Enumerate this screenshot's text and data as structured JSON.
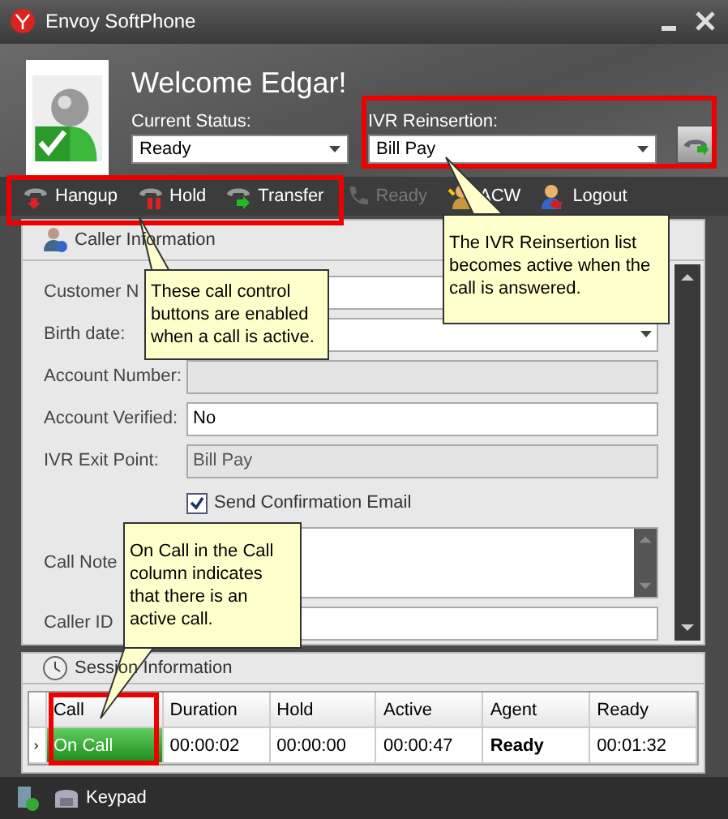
{
  "window": {
    "title": "Envoy SoftPhone"
  },
  "header": {
    "welcome": "Welcome Edgar!",
    "status_label": "Current Status:",
    "status_value": "Ready",
    "ivr_label": "IVR Reinsertion:",
    "ivr_value": "Bill Pay"
  },
  "toolbar": [
    {
      "label": "Hangup",
      "disabled": false
    },
    {
      "label": "Hold",
      "disabled": false
    },
    {
      "label": "Transfer",
      "disabled": false
    },
    {
      "label": "Ready",
      "disabled": true
    },
    {
      "label": "ACW",
      "disabled": false
    },
    {
      "label": "Logout",
      "disabled": false
    }
  ],
  "caller_panel": {
    "title": "Caller Information",
    "fields": [
      {
        "kind": "text",
        "label": "Customer N"
      },
      {
        "kind": "dropdown",
        "label": "Birth date:"
      },
      {
        "kind": "readonly",
        "label": "Account Number:"
      },
      {
        "kind": "text",
        "label": "Account Verified:",
        "value": "No"
      },
      {
        "kind": "readonly",
        "label": "IVR Exit Point:",
        "value": "Bill Pay"
      },
      {
        "kind": "checkbox",
        "label": "Send Confirmation Email",
        "checked": true
      },
      {
        "kind": "textarea",
        "label": "Call Note"
      },
      {
        "kind": "text",
        "label": "Caller ID"
      }
    ]
  },
  "session_panel": {
    "title": "Session Information",
    "columns": [
      "Call",
      "Duration",
      "Hold",
      "Active",
      "Agent",
      "Ready"
    ],
    "rows": [
      {
        "selected": true,
        "cells": [
          {
            "text": "On Call",
            "active": true
          },
          {
            "text": "00:00:02"
          },
          {
            "text": "00:00:00"
          },
          {
            "text": "00:00:47"
          },
          {
            "text": "Ready",
            "bold": true
          },
          {
            "text": "00:01:32"
          }
        ]
      }
    ]
  },
  "status_bar": {
    "keypad": "Keypad"
  },
  "callouts": [
    {
      "text": "The IVR Reinsertion list becomes active when the call is answered."
    },
    {
      "text": "These call control buttons are enabled when a call is active."
    },
    {
      "text": "On Call in the Call column indicates that there is an active call."
    }
  ]
}
